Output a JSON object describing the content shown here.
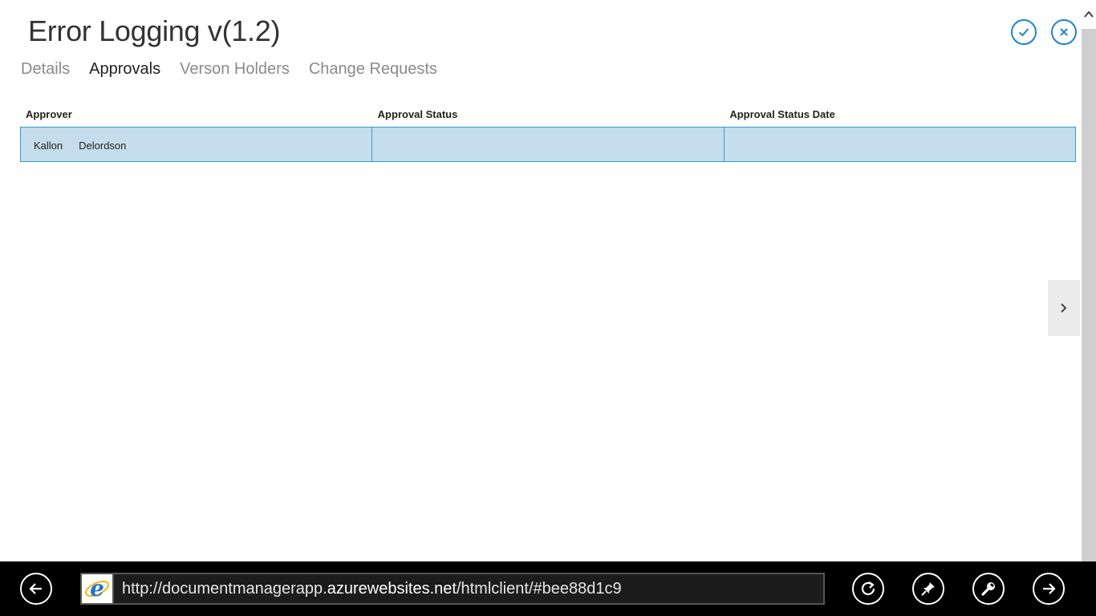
{
  "app": {
    "title": "Error Logging v(1.2)",
    "tabs": [
      {
        "label": "Details",
        "active": false
      },
      {
        "label": "Approvals",
        "active": true
      },
      {
        "label": "Verson Holders",
        "active": false
      },
      {
        "label": "Change Requests",
        "active": false
      }
    ],
    "actions": {
      "confirm_icon": "checkmark-icon",
      "cancel_icon": "close-icon"
    },
    "table": {
      "columns": [
        "Approver",
        "Approval Status",
        "Approval Status Date"
      ],
      "rows": [
        {
          "approver_first": "Kallon",
          "approver_last": "Delordson",
          "status": "",
          "status_date": ""
        }
      ]
    }
  },
  "browser": {
    "url_prefix": "http://documentmanagerapp.",
    "url_domain": "azurewebsites.net",
    "url_suffix": "/htmlclient/#bee88d1c9",
    "icons": [
      "back-icon",
      "ie-logo-icon",
      "refresh-icon",
      "pin-icon",
      "tools-icon",
      "forward-icon"
    ]
  },
  "colors": {
    "accent": "#1a86d0",
    "row_selected": "#c5dcec",
    "row_border": "#2aa0d8"
  }
}
